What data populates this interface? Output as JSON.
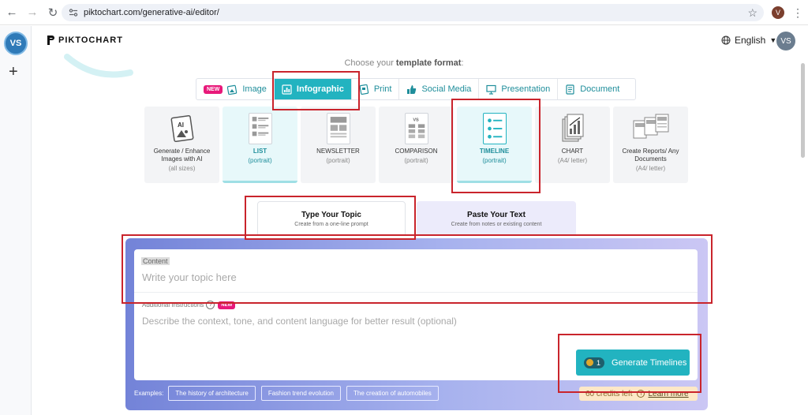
{
  "browser": {
    "url": "piktochart.com/generative-ai/editor/",
    "profile_initial": "V"
  },
  "rail": {
    "avatar": "VS",
    "add": "+"
  },
  "header": {
    "logo": "PIKTOCHART",
    "language": "English",
    "user_initials": "VS"
  },
  "choose": {
    "prefix": "Choose your ",
    "bold": "template format",
    "suffix": ":"
  },
  "formats": [
    {
      "label": "Image",
      "badge": "NEW"
    },
    {
      "label": "Infographic",
      "active": true
    },
    {
      "label": "Print"
    },
    {
      "label": "Social Media"
    },
    {
      "label": "Presentation"
    },
    {
      "label": "Document"
    }
  ],
  "templates": [
    {
      "title": "Generate / Enhance Images with AI",
      "sub": "(all sizes)"
    },
    {
      "title": "LIST",
      "sub": "(portrait)",
      "selected": true
    },
    {
      "title": "NEWSLETTER",
      "sub": "(portrait)"
    },
    {
      "title": "COMPARISON",
      "sub": "(portrait)"
    },
    {
      "title": "TIMELINE",
      "sub": "(portrait)",
      "selected": true
    },
    {
      "title": "CHART",
      "sub": "(A4/ letter)"
    },
    {
      "title": "Create Reports/ Any Documents",
      "sub": "(A4/ letter)"
    }
  ],
  "modes": [
    {
      "title": "Type Your Topic",
      "sub": "Create from a one-line prompt"
    },
    {
      "title": "Paste Your Text",
      "sub": "Create from notes or existing content"
    }
  ],
  "form": {
    "content_label": "Content",
    "topic_placeholder": "Write your topic here",
    "addl_label": "Additional Instructions",
    "addl_badge": "NEW",
    "desc_placeholder": "Describe the context, tone, and content language for better result (optional)",
    "generate_credits": "1",
    "generate_label": "Generate Timelines",
    "credits_left": "60 credits left",
    "learn_more": "Learn more",
    "examples_label": "Examples:",
    "examples": [
      "The history of architecture",
      "Fashion trend evolution",
      "The creation of automobiles"
    ]
  },
  "colors": {
    "accent": "#22b3c0",
    "badge": "#e8197a",
    "annotation": "#c9242c"
  }
}
